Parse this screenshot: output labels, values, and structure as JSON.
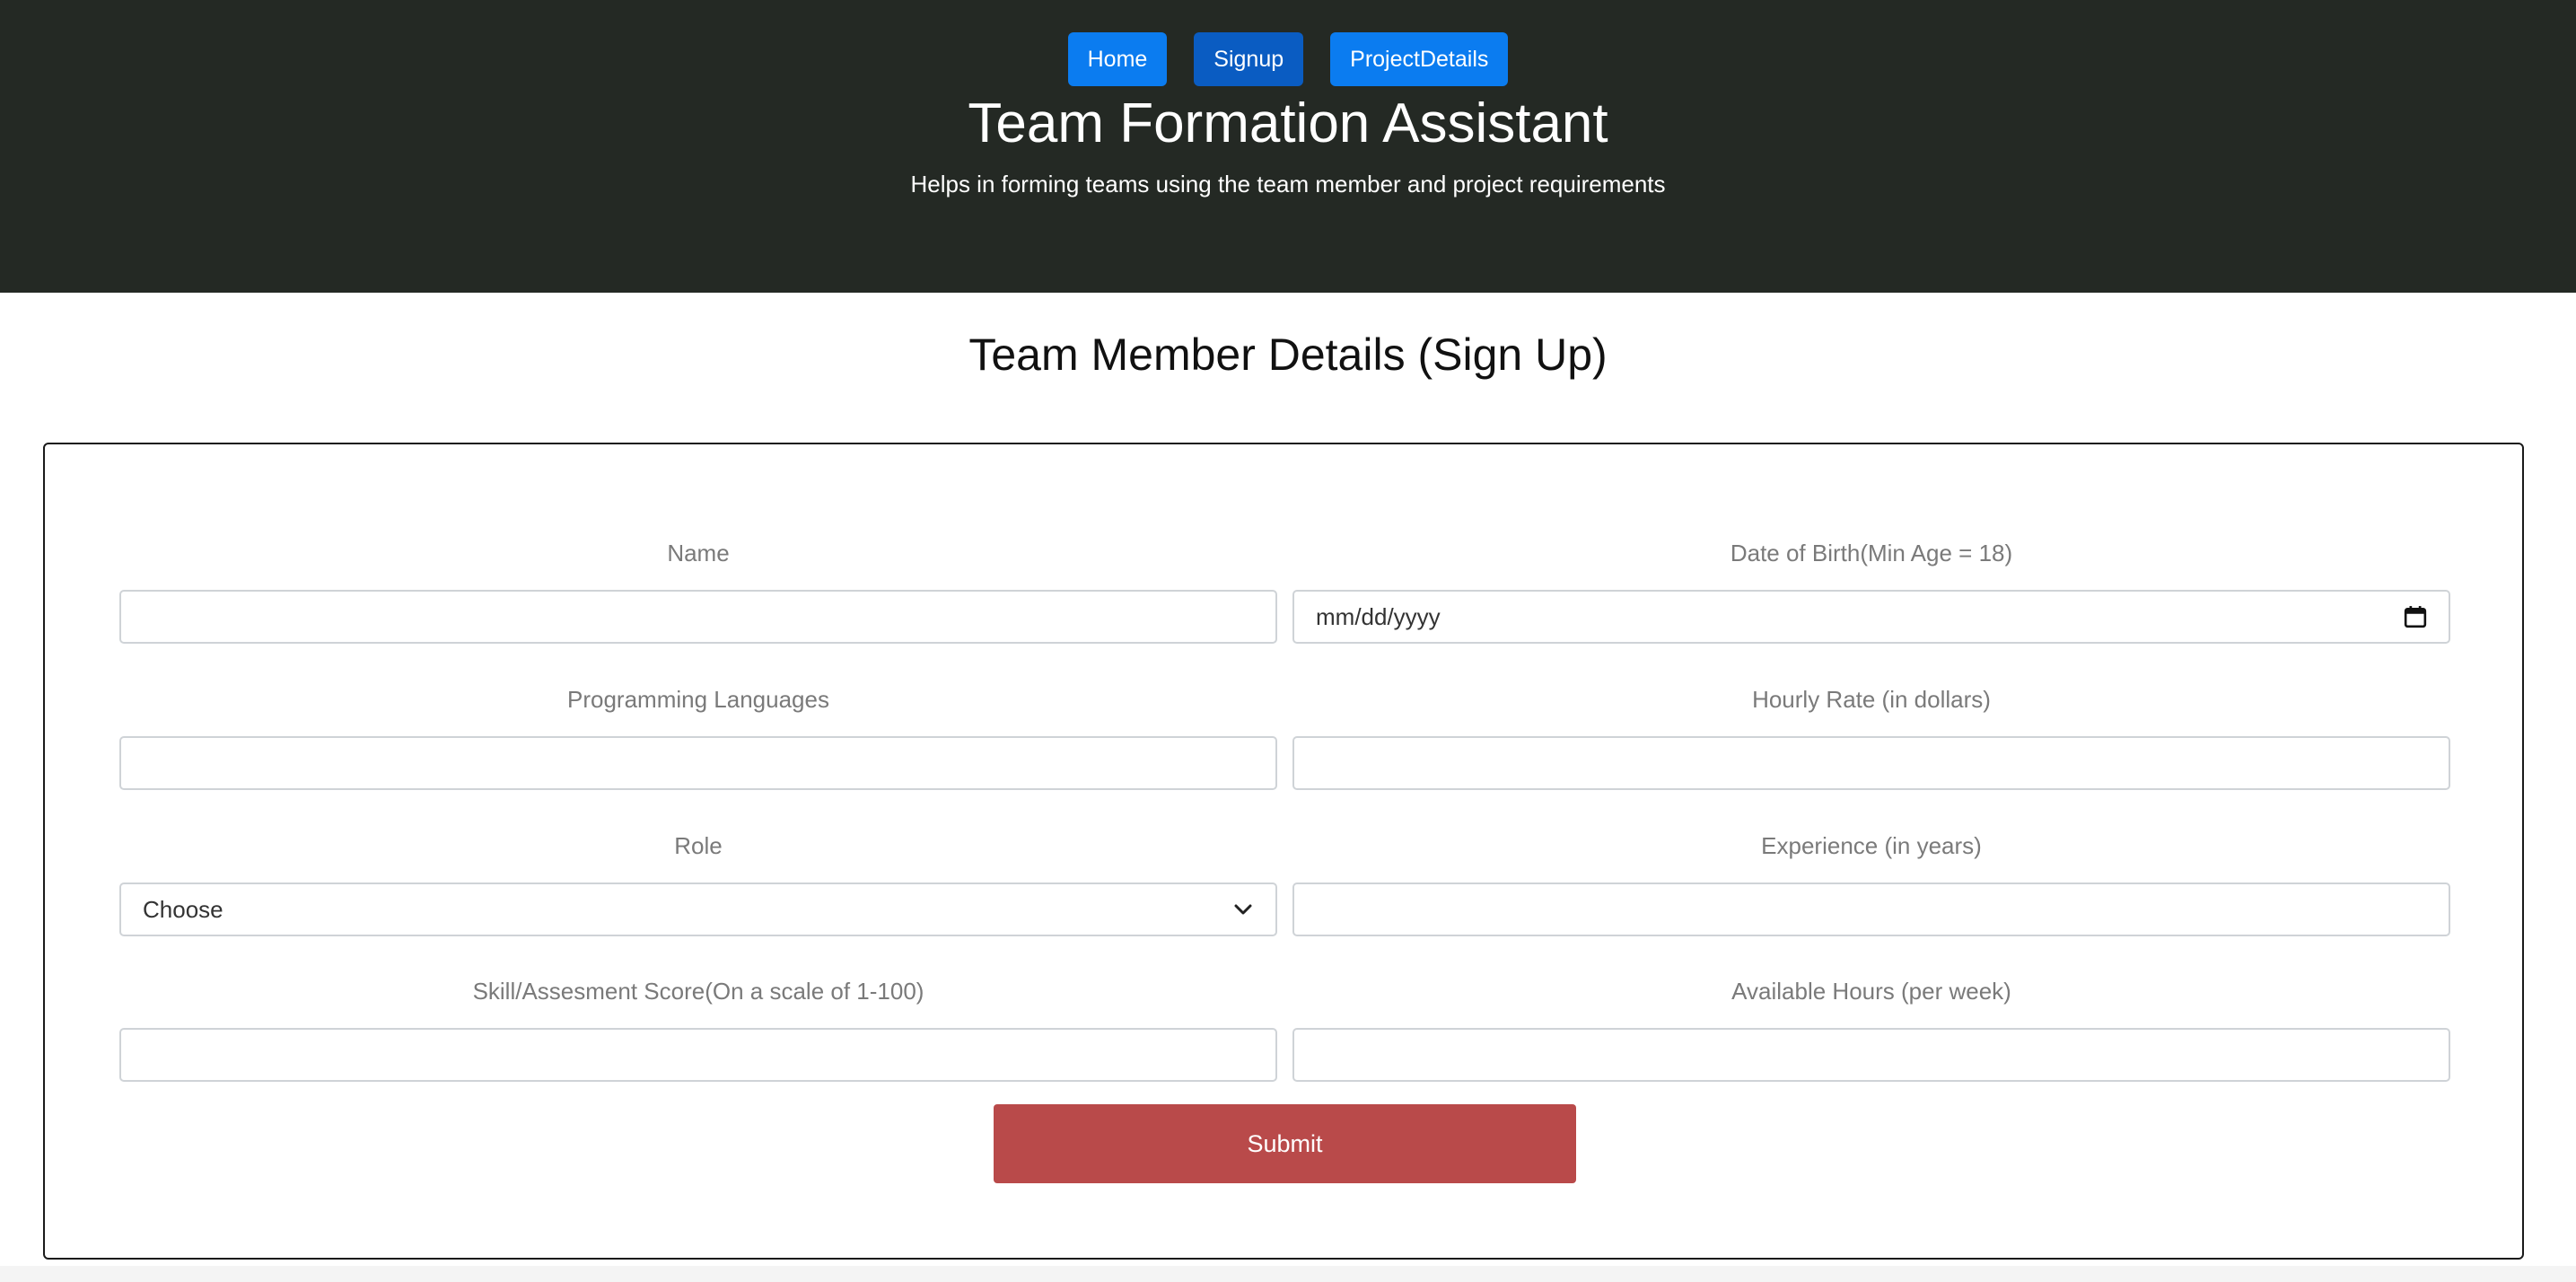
{
  "nav": {
    "items": [
      {
        "label": "Home"
      },
      {
        "label": "Signup"
      },
      {
        "label": "ProjectDetails"
      }
    ],
    "active": "Signup"
  },
  "header": {
    "title": "Team Formation Assistant",
    "subtitle": "Helps in forming teams using the team member and project requirements"
  },
  "page": {
    "title": "Team Member Details (Sign Up)"
  },
  "form": {
    "name_label": "Name",
    "dob_label": "Date of Birth(Min Age = 18)",
    "dob_placeholder": "mm/dd/yyyy",
    "languages_label": "Programming Languages",
    "rate_label": "Hourly Rate (in dollars)",
    "role_label": "Role",
    "role_selected": "Choose",
    "experience_label": "Experience (in years)",
    "skill_label": "Skill/Assesment Score(On a scale of 1-100)",
    "hours_label": "Available Hours (per week)",
    "submit_label": "Submit"
  },
  "colors": {
    "header_bg": "#242924",
    "nav_button": "#0b7cf0",
    "nav_button_active": "#0a5cc2",
    "submit_button": "#b94a4a"
  }
}
